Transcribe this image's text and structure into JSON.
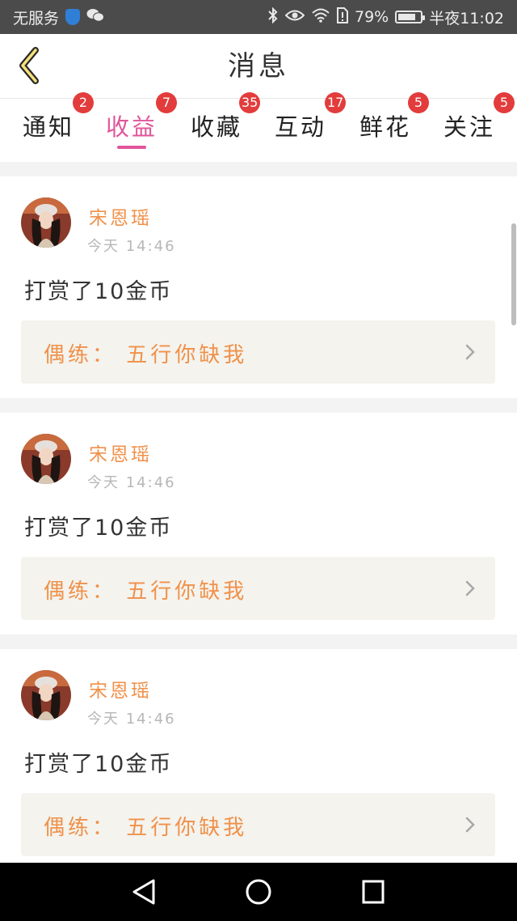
{
  "status_bar": {
    "carrier": "无服务",
    "battery": "79%",
    "battery_level": 0.79,
    "time": "半夜11:02",
    "icons": [
      "shield-icon",
      "wechat-icon",
      "bluetooth-icon",
      "eye-icon",
      "wifi-icon",
      "sim-icon",
      "battery-icon"
    ]
  },
  "header": {
    "title": "消息",
    "back_icon": "chevron-left-icon"
  },
  "tabs": [
    {
      "label": "通知",
      "badge": "2"
    },
    {
      "label": "收益",
      "badge": "7",
      "active": true
    },
    {
      "label": "收藏",
      "badge": "35"
    },
    {
      "label": "互动",
      "badge": "17"
    },
    {
      "label": "鲜花",
      "badge": "5"
    },
    {
      "label": "关注",
      "badge": "5"
    }
  ],
  "messages": [
    {
      "sender": "宋恩瑶",
      "time": "今天  14:46",
      "text": "打赏了10金币",
      "work": "偶练： 五行你缺我"
    },
    {
      "sender": "宋恩瑶",
      "time": "今天  14:46",
      "text": "打赏了10金币",
      "work": "偶练： 五行你缺我"
    },
    {
      "sender": "宋恩瑶",
      "time": "今天  14:46",
      "text": "打赏了10金币",
      "work": "偶练： 五行你缺我"
    }
  ],
  "nav_bar": {
    "icons": [
      "back-triangle-icon",
      "home-circle-icon",
      "recents-square-icon"
    ]
  },
  "colors": {
    "accent": "#e0569a",
    "sender": "#f0914a",
    "badge": "#e23c3c",
    "status_bar": "#4b4b4b"
  }
}
